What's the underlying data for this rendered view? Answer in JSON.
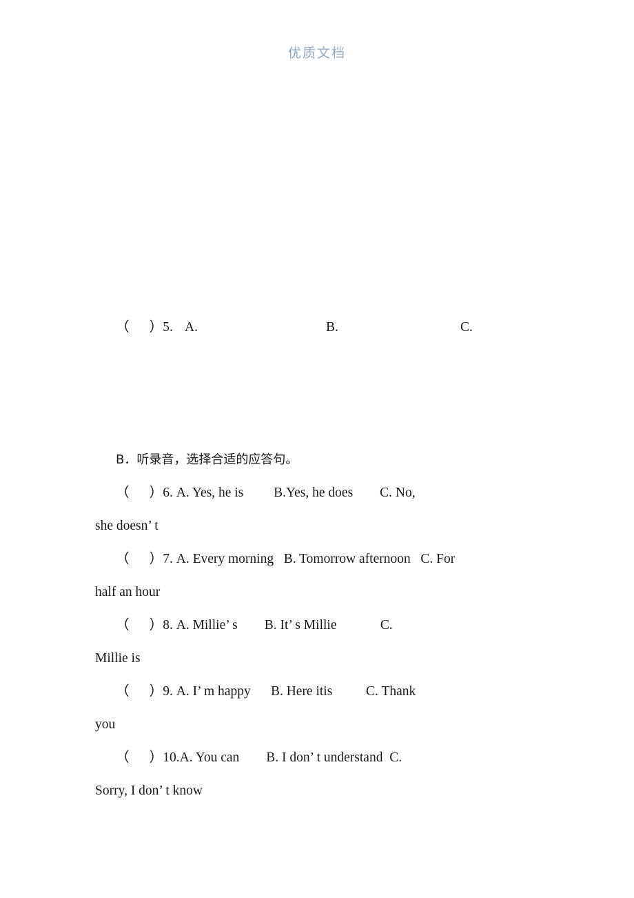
{
  "watermark": {
    "text": "优质文档",
    "color_start": "#6a86a8",
    "color_end": "#cfdae6"
  },
  "document": {
    "type": "listening-exam-worksheet",
    "language": "zh-CN/en",
    "page_background": "#ffffff",
    "text_color": "#1a1a1a"
  },
  "question5": {
    "marker": "（      ）5.",
    "option_a": "A.",
    "option_b": "B.",
    "option_c": "C."
  },
  "section_b": {
    "heading": "B．听录音，选择合适的应答句。"
  },
  "questions": [
    {
      "number": "6",
      "line1": "（      ）6. A. Yes, he is         B.Yes, he does        C. No,",
      "line2": "she doesn’ t"
    },
    {
      "number": "7",
      "line1": "（      ）7. A. Every morning   B. Tomorrow afternoon   C. For",
      "line2": "half an hour"
    },
    {
      "number": "8",
      "line1": "（      ）8. A. Millie’ s        B. It’ s Millie             C.",
      "line2": "Millie is"
    },
    {
      "number": "9",
      "line1": "（      ）9. A. I’ m happy      B. Here itis          C. Thank",
      "line2": "you"
    },
    {
      "number": "10",
      "line1": "（      ）10.A. You can        B. I don’ t understand  C.",
      "line2": "Sorry, I don’ t know"
    }
  ]
}
